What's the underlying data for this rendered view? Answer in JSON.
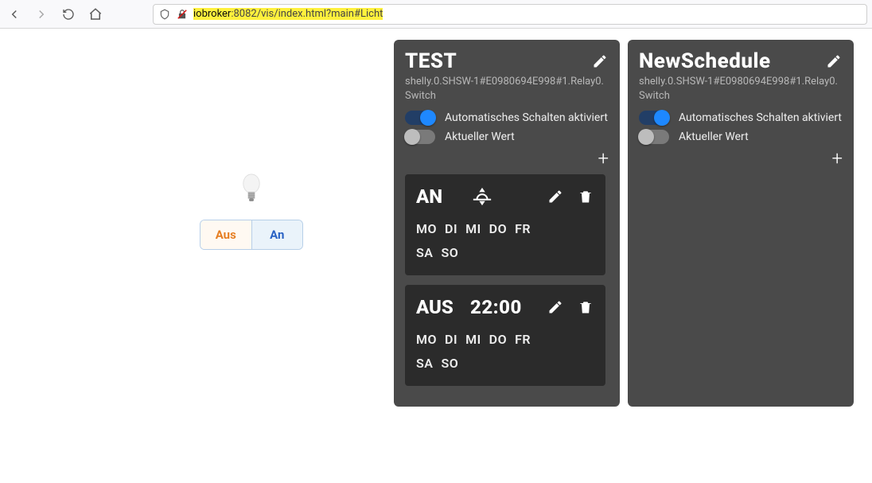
{
  "browser": {
    "url_highlighted_full": "iobroker:8082/vis/index.html?main#Licht",
    "url_host": "iobroker",
    "url_rest": ":8082/vis/index.html?main#Licht"
  },
  "left_panel": {
    "off_label": "Aus",
    "on_label": "An"
  },
  "cards": [
    {
      "title": "TEST",
      "subtitle": "shelly.0.SHSW-1#E0980694E998#1.Relay0.Switch",
      "auto_row": {
        "label": "Automatisches Schalten aktiviert",
        "on": true
      },
      "current_row": {
        "label": "Aktueller Wert",
        "on": false
      },
      "entries": [
        {
          "state": "AN",
          "time_mode": "astro",
          "days": [
            "MO",
            "DI",
            "MI",
            "DO",
            "FR",
            "SA",
            "SO"
          ]
        },
        {
          "state": "AUS",
          "time_mode": "clock",
          "time": "22:00",
          "days": [
            "MO",
            "DI",
            "MI",
            "DO",
            "FR",
            "SA",
            "SO"
          ]
        }
      ]
    },
    {
      "title": "NewSchedule",
      "subtitle": "shelly.0.SHSW-1#E0980694E998#1.Relay0.Switch",
      "auto_row": {
        "label": "Automatisches Schalten aktiviert",
        "on": true
      },
      "current_row": {
        "label": "Aktueller Wert",
        "on": false
      },
      "entries": []
    }
  ]
}
